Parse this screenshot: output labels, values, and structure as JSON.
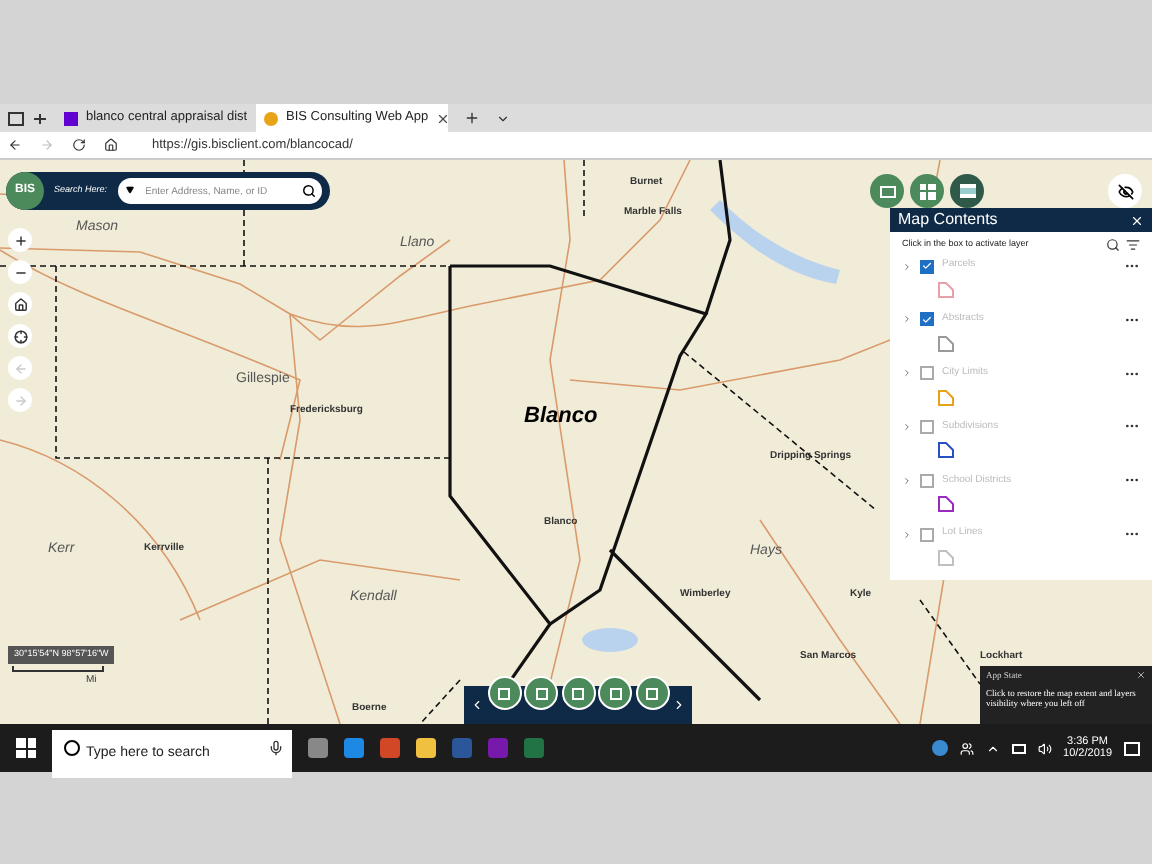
{
  "browser": {
    "tabs": [
      {
        "title": "blanco central appraisal dist",
        "selected": false
      },
      {
        "title": "BIS Consulting Web App",
        "selected": true
      }
    ],
    "url": "https://gis.bisclient.com/blancocad/"
  },
  "app": {
    "logo": "BIS",
    "search_label": "Search Here:",
    "search": {
      "placeholder": "Enter Address, Name, or ID"
    }
  },
  "map": {
    "labels": [
      {
        "text": "Burnet",
        "kind": "town"
      },
      {
        "text": "Marble Falls",
        "kind": "town"
      },
      {
        "text": "Mason",
        "kind": "county"
      },
      {
        "text": "Llano",
        "kind": "county"
      },
      {
        "text": "Gillespie",
        "kind": "region"
      },
      {
        "text": "Fredericksburg",
        "kind": "town"
      },
      {
        "text": "Blanco",
        "kind": "focus"
      },
      {
        "text": "Dripping Springs",
        "kind": "town"
      },
      {
        "text": "Blanco",
        "kind": "town"
      },
      {
        "text": "Kerr",
        "kind": "county"
      },
      {
        "text": "Kerrville",
        "kind": "town"
      },
      {
        "text": "Hays",
        "kind": "county"
      },
      {
        "text": "Kendall",
        "kind": "county"
      },
      {
        "text": "Wimberley",
        "kind": "town"
      },
      {
        "text": "Kyle",
        "kind": "town"
      },
      {
        "text": "San Marcos",
        "kind": "town"
      },
      {
        "text": "Lockhart",
        "kind": "town"
      },
      {
        "text": "Boerne",
        "kind": "town"
      }
    ],
    "coordinates": "30°15'54\"N 98°57'16\"W",
    "scale_unit": "Mi"
  },
  "map_contents": {
    "title": "Map Contents",
    "hint": "Click in the box to activate layer",
    "layers": [
      {
        "name": "Parcels",
        "checked": true,
        "color": "#e8a0a8"
      },
      {
        "name": "Abstracts",
        "checked": true,
        "color": "#9a9a9a"
      },
      {
        "name": "City Limits",
        "checked": false,
        "color": "#e6a21a"
      },
      {
        "name": "Subdivisions",
        "checked": false,
        "color": "#2a4fc0"
      },
      {
        "name": "School Districts",
        "checked": false,
        "color": "#9b2ac0"
      },
      {
        "name": "Lot Lines",
        "checked": false,
        "color": "#c0c0c0"
      }
    ]
  },
  "tooltip": {
    "title": "App State",
    "text": "Click to restore the map extent and layers visibility where you left off"
  },
  "taskbar": {
    "search": {
      "placeholder": "Type here to search"
    },
    "time": "3:36 PM",
    "date": "10/2/2019"
  }
}
